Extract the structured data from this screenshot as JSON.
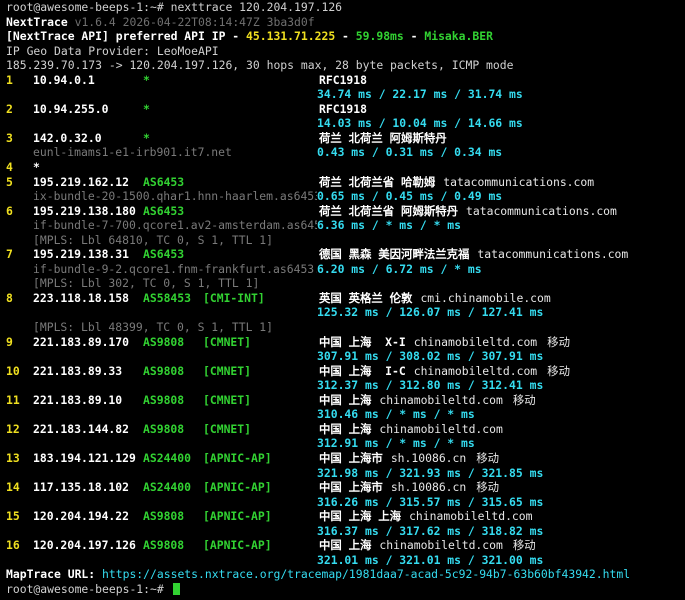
{
  "terminal": {
    "command_line": "root@awesome-beeps-1:~# nexttrace 120.204.197.126",
    "banner": {
      "name": "NextTrace",
      "version": "v1.6.4 2026-04-22T08:14:47Z 3ba3d0f"
    },
    "api_line": {
      "prefix": "[NextTrace API] preferred API IP - ",
      "ip": "45.131.71.225",
      "sep1": " - ",
      "latency": "59.98ms",
      "sep2": " - ",
      "node": "Misaka.BER"
    },
    "geo_provider": "IP Geo Data Provider: LeoMoeAPI",
    "trace_summary": "185.239.70.173 -> 120.204.197.126, 30 hops max, 28 byte packets, ICMP mode",
    "hops": [
      {
        "num": "1",
        "ip": "10.94.0.1",
        "asn": "*",
        "tag": "",
        "geo": "RFC1918",
        "domain": "",
        "isp": "",
        "rdns": "",
        "rtt": "34.74 ms / 22.17 ms / 31.74 ms"
      },
      {
        "num": "2",
        "ip": "10.94.255.0",
        "asn": "*",
        "tag": "",
        "geo": "RFC1918",
        "domain": "",
        "isp": "",
        "rdns": "",
        "rtt": "14.03 ms / 10.04 ms / 14.66 ms"
      },
      {
        "num": "3",
        "ip": "142.0.32.0",
        "asn": "*",
        "tag": "",
        "geo": "荷兰 北荷兰 阿姆斯特丹",
        "domain": "",
        "isp": "",
        "rdns": "eunl-imams1-e1-irb901.it7.net",
        "rtt": "0.43 ms / 0.31 ms / 0.34 ms"
      },
      {
        "num": "4",
        "ip": "*"
      },
      {
        "num": "5",
        "ip": "195.219.162.12",
        "asn": "AS6453",
        "tag": "",
        "geo": "荷兰 北荷兰省 哈勒姆",
        "domain": "tatacommunications.com",
        "isp": "",
        "rdns": "ix-bundle-20-1500.qhar1.hnn-haarlem.as6453.net",
        "rtt": "0.65 ms / 0.45 ms / 0.49 ms"
      },
      {
        "num": "6",
        "ip": "195.219.138.180",
        "asn": "AS6453",
        "tag": "",
        "geo": "荷兰 北荷兰省 阿姆斯特丹",
        "domain": "tatacommunications.com",
        "isp": "",
        "rdns": "if-bundle-7-700.qcore1.av2-amsterdam.as6453.net",
        "rtt": "6.36 ms / * ms / * ms",
        "mpls": "[MPLS: Lbl 64810, TC 0, S 1, TTL 1]"
      },
      {
        "num": "7",
        "ip": "195.219.138.31",
        "asn": "AS6453",
        "tag": "",
        "geo": "德国 黑森 美因河畔法兰克福",
        "domain": "tatacommunications.com",
        "isp": "",
        "rdns": "if-bundle-9-2.qcore1.fnm-frankfurt.as6453.net",
        "rtt": "6.20 ms / 6.72 ms / * ms",
        "mpls": "[MPLS: Lbl 302, TC 0, S 1, TTL 1]"
      },
      {
        "num": "8",
        "ip": "223.118.18.158",
        "asn": "AS58453",
        "tag": "[CMI-INT]",
        "geo": "英国 英格兰 伦敦",
        "domain": "cmi.chinamobile.com",
        "isp": "",
        "rdns": "",
        "rtt": "125.32 ms / 126.07 ms / 127.41 ms",
        "mpls": "[MPLS: Lbl 48399, TC 0, S 1, TTL 1]"
      },
      {
        "num": "9",
        "ip": "221.183.89.170",
        "asn": "AS9808",
        "tag": "[CMNET]",
        "geo": "中国 上海  X-I",
        "domain": "chinamobileltd.com",
        "isp": "移动",
        "rdns": "",
        "rtt": "307.91 ms / 308.02 ms / 307.91 ms"
      },
      {
        "num": "10",
        "ip": "221.183.89.33",
        "asn": "AS9808",
        "tag": "[CMNET]",
        "geo": "中国 上海  I-C",
        "domain": "chinamobileltd.com",
        "isp": "移动",
        "rdns": "",
        "rtt": "312.37 ms / 312.80 ms / 312.41 ms"
      },
      {
        "num": "11",
        "ip": "221.183.89.10",
        "asn": "AS9808",
        "tag": "[CMNET]",
        "geo": "中国 上海",
        "domain": "chinamobileltd.com",
        "isp": "移动",
        "rdns": "",
        "rtt": "310.46 ms / * ms / * ms"
      },
      {
        "num": "12",
        "ip": "221.183.144.82",
        "asn": "AS9808",
        "tag": "[CMNET]",
        "geo": "中国 上海",
        "domain": "chinamobileltd.com",
        "isp": "",
        "rdns": "",
        "rtt": "312.91 ms / * ms / * ms"
      },
      {
        "num": "13",
        "ip": "183.194.121.129",
        "asn": "AS24400",
        "tag": "[APNIC-AP]",
        "geo": "中国 上海市",
        "domain": "sh.10086.cn",
        "isp": "移动",
        "rdns": "",
        "rtt": "321.98 ms / 321.93 ms / 321.85 ms"
      },
      {
        "num": "14",
        "ip": "117.135.18.102",
        "asn": "AS24400",
        "tag": "[APNIC-AP]",
        "geo": "中国 上海市",
        "domain": "sh.10086.cn",
        "isp": "移动",
        "rdns": "",
        "rtt": "316.26 ms / 315.57 ms / 315.65 ms"
      },
      {
        "num": "15",
        "ip": "120.204.194.22",
        "asn": "AS9808",
        "tag": "[APNIC-AP]",
        "geo": "中国 上海 上海",
        "domain": "chinamobileltd.com",
        "isp": "",
        "rdns": "",
        "rtt": "316.37 ms / 317.62 ms / 318.82 ms"
      },
      {
        "num": "16",
        "ip": "120.204.197.126",
        "asn": "AS9808",
        "tag": "[APNIC-AP]",
        "geo": "中国 上海",
        "domain": "chinamobileltd.com",
        "isp": "移动",
        "rdns": "",
        "rtt": "321.01 ms / 321.01 ms / 321.00 ms"
      }
    ],
    "maptrace": {
      "label": "MapTrace URL: ",
      "url": "https://assets.nxtrace.org/tracemap/1981daa7-acad-5c92-94b7-63b60bf43942.html"
    },
    "prompt": "root@awesome-beeps-1:~# "
  },
  "colors": {
    "background": "#000000",
    "hop_number": "#f0e020",
    "asn": "#32d232",
    "latency": "#35dcf0",
    "rdns": "#7a7a7a",
    "cursor": "#32d232"
  }
}
